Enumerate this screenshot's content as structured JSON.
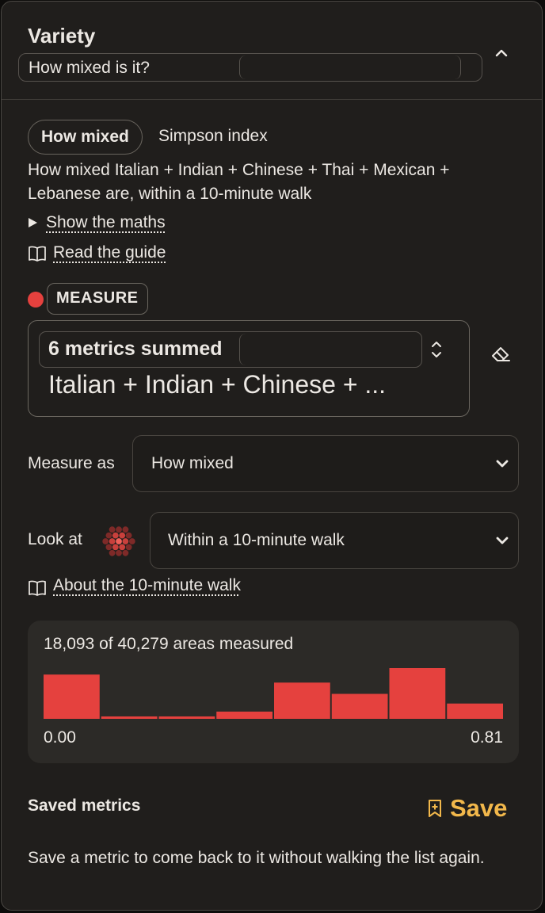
{
  "header": {
    "title": "Variety",
    "subtitle": "How mixed is it?"
  },
  "summary": {
    "pill_label": "How mixed",
    "index_label": "Simpson index",
    "description": "How mixed Italian + Indian + Chinese + Thai + Mexican + Lebanese are, within a 10-minute walk",
    "show_maths": "Show the maths",
    "read_guide": "Read the guide"
  },
  "measure": {
    "label": "MEASURE",
    "dot_color": "#e5413e",
    "selector_title": "6 metrics summed",
    "selector_value": "Italian + Indian + Chinese + ..."
  },
  "controls": {
    "measure_as_label": "Measure as",
    "measure_as_value": "How mixed",
    "look_at_label": "Look at",
    "look_at_value": "Within a 10-minute walk",
    "about_link": "About the 10-minute walk"
  },
  "histogram": {
    "title": "18,093 of 40,279 areas measured",
    "min_label": "0.00",
    "max_label": "0.81",
    "bar_color": "#e5413e"
  },
  "chart_data": {
    "type": "bar",
    "values": [
      55,
      3,
      3,
      9,
      45,
      31,
      63,
      19
    ]
  },
  "saved": {
    "title": "Saved metrics",
    "save_label": "Save",
    "save_color": "#f2b84b",
    "empty_text": "Save a metric to come back to it without walking the list again."
  },
  "icons": [
    "chevron-up-icon",
    "book-icon",
    "up-down-icon",
    "eraser-icon",
    "chevron-down-icon",
    "hex-grid-icon",
    "bookmark-plus-icon"
  ]
}
